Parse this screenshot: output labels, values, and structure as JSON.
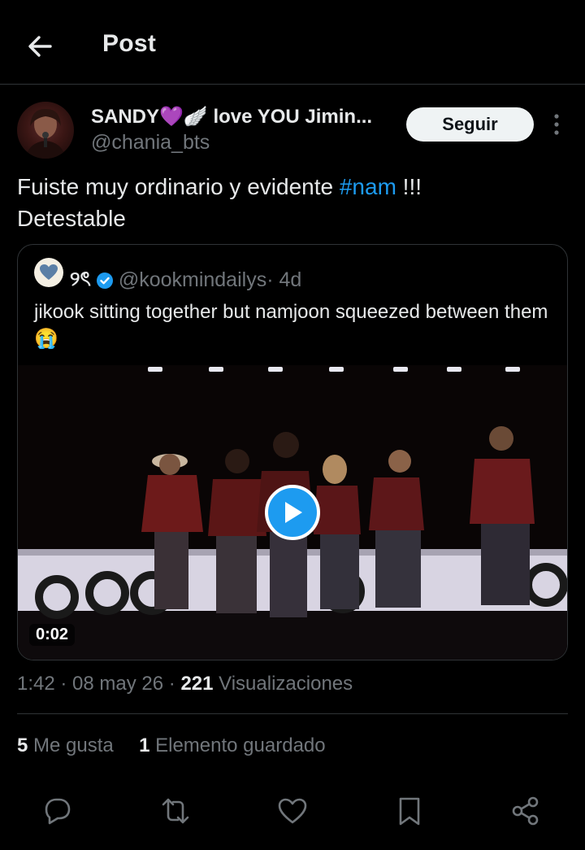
{
  "header": {
    "title": "Post",
    "back_icon": "arrow-left-icon"
  },
  "post": {
    "author_name": "SANDY💜🪽 love YOU Jimin...",
    "author_handle": "@chania_bts",
    "follow_label": "Seguir",
    "text_before": "Fuiste muy ordinario y evidente ",
    "hashtag": "#nam",
    "text_after": " !!!\nDetestable",
    "timestamp": "1:42 · 08 may 26 · ",
    "views_count": "221",
    "views_label": " Visualizaciones",
    "likes_count": "5",
    "likes_label": " Me gusta",
    "saves_count": "1",
    "saves_label": " Elemento guardado"
  },
  "quote": {
    "author_name": "୨ৎ",
    "author_handle": "@kookmindailys",
    "time": " · 4d",
    "text": "jikook sitting together but namjoon squeezed between them 😭",
    "video_duration": "0:02"
  },
  "actions": [
    "reply-icon",
    "repost-icon",
    "like-icon",
    "bookmark-icon",
    "share-icon"
  ],
  "colors": {
    "accent": "#1d9bf0",
    "background": "#000000",
    "muted": "#71767b",
    "text": "#e7e9ea"
  }
}
